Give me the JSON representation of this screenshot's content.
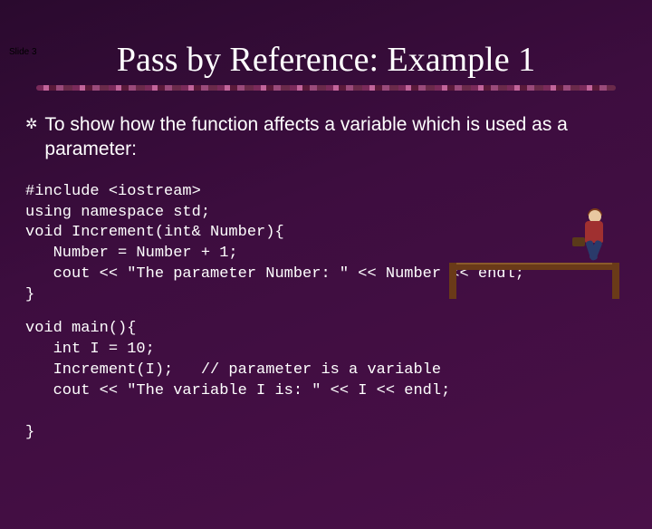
{
  "slide_label": "Slide 3",
  "title": "Pass by Reference: Example 1",
  "bullet": "To show how the function affects a variable which is used as a parameter:",
  "code1": "#include <iostream>\nusing namespace std;\nvoid Increment(int& Number){\n   Number = Number + 1;\n   cout << \"The parameter Number: \" << Number << endl;\n}",
  "code2": "void main(){\n   int I = 10;\n   Increment(I);   // parameter is a variable\n   cout << \"The variable I is: \" << I << endl;\n\n}"
}
